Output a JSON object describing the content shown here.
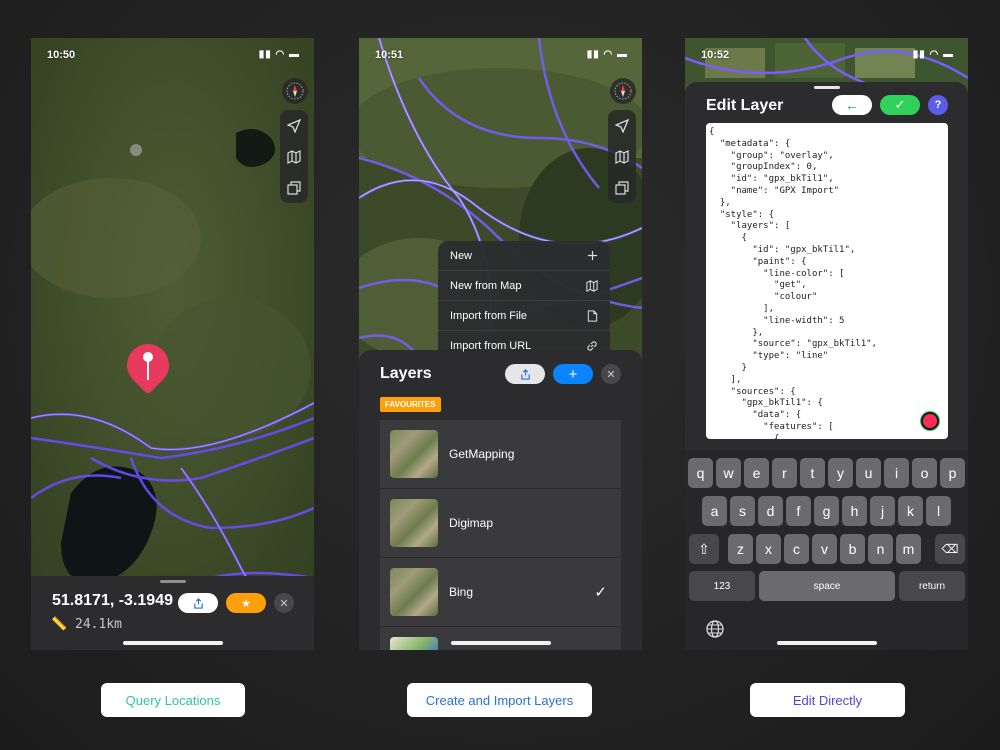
{
  "captions": {
    "query": "Query Locations",
    "layers": "Create and Import Layers",
    "edit": "Edit Directly"
  },
  "caption_colors": {
    "query": "#2ec7a1",
    "layers": "#2d6fd6",
    "edit": "#5b3fd6"
  },
  "phone1": {
    "time": "10:50",
    "coords": "51.8171, -3.1949",
    "distance": "24.1km"
  },
  "phone2": {
    "time": "10:51",
    "menu": [
      {
        "label": "New",
        "icon": "plus-icon"
      },
      {
        "label": "New from Map",
        "icon": "map-icon"
      },
      {
        "label": "Import from File",
        "icon": "file-icon"
      },
      {
        "label": "Import from URL",
        "icon": "link-icon"
      }
    ],
    "layers_title": "Layers",
    "favourites": "FAVOURITES",
    "layers": [
      {
        "name": "GetMapping",
        "checked": false
      },
      {
        "name": "Digimap",
        "checked": false
      },
      {
        "name": "Bing",
        "checked": true
      }
    ]
  },
  "phone3": {
    "time": "10:52",
    "title": "Edit Layer",
    "code": "{\n  \"metadata\": {\n    \"group\": \"overlay\",\n    \"groupIndex\": 0,\n    \"id\": \"gpx_bkTil1\",\n    \"name\": \"GPX Import\"\n  },\n  \"style\": {\n    \"layers\": [\n      {\n        \"id\": \"gpx_bkTil1\",\n        \"paint\": {\n          \"line-color\": [\n            \"get\",\n            \"colour\"\n          ],\n          \"line-width\": 5\n        },\n        \"source\": \"gpx_bkTil1\",\n        \"type\": \"line\"\n      }\n    ],\n    \"sources\": {\n      \"gpx_bkTil1\": {\n        \"data\": {\n          \"features\": [\n            {",
    "help": "?",
    "keyboard": {
      "row1": [
        "q",
        "w",
        "e",
        "r",
        "t",
        "y",
        "u",
        "i",
        "o",
        "p"
      ],
      "row2": [
        "a",
        "s",
        "d",
        "f",
        "g",
        "h",
        "j",
        "k",
        "l"
      ],
      "row3": [
        "z",
        "x",
        "c",
        "v",
        "b",
        "n",
        "m"
      ],
      "numbers": "123",
      "space": "space",
      "return": "return"
    }
  }
}
